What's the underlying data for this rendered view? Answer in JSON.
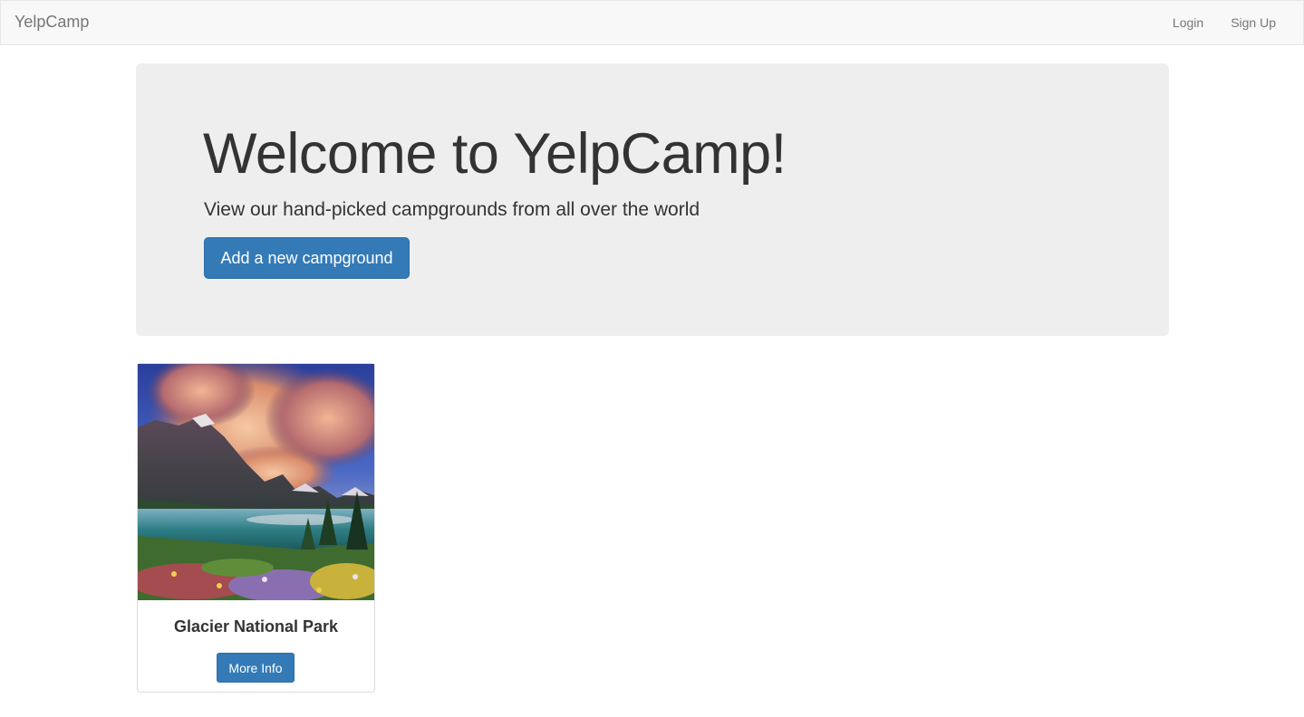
{
  "navbar": {
    "brand": "YelpCamp",
    "links": [
      {
        "label": "Login"
      },
      {
        "label": "Sign Up"
      }
    ]
  },
  "jumbotron": {
    "title": "Welcome to YelpCamp!",
    "subtitle": "View our hand-picked campgrounds from all over the world",
    "add_button_label": "Add a new campground"
  },
  "campgrounds": [
    {
      "name": "Glacier National Park",
      "more_info_label": "More Info"
    }
  ],
  "colors": {
    "primary": "#337ab7",
    "navbar_bg": "#f8f8f8",
    "jumbotron_bg": "#eeeeee",
    "text": "#333333",
    "muted": "#777777"
  }
}
